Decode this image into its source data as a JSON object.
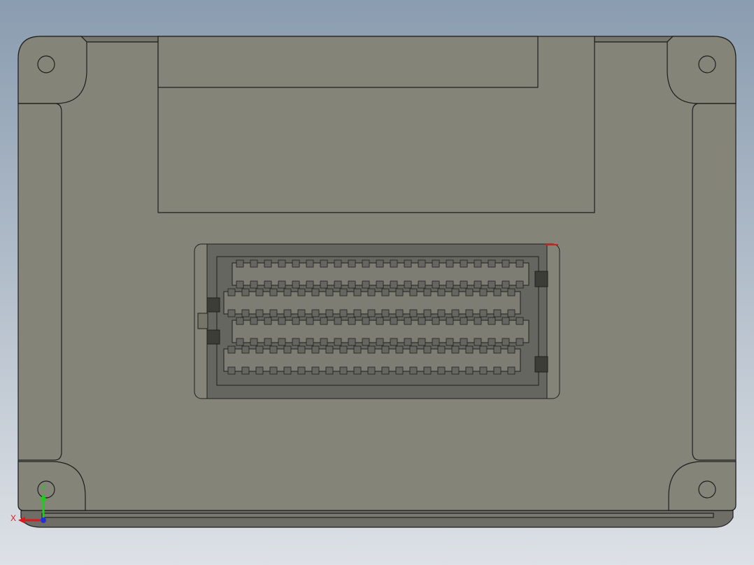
{
  "viewport": {
    "background_top": "#8a9cb0",
    "background_bottom": "#dde1e6"
  },
  "model": {
    "body_color": "#858479",
    "edge_color": "#1e1e1e",
    "connector_color": "#666660",
    "connector_slot_color": "#7e7d74",
    "connector_pin_count_per_row": 21,
    "connector_row_count": 4
  },
  "triad": {
    "x_label": "X",
    "y_label": "Y",
    "x_color": "#e01818",
    "y_color": "#1ecc1e",
    "z_color": "#2030e0"
  }
}
